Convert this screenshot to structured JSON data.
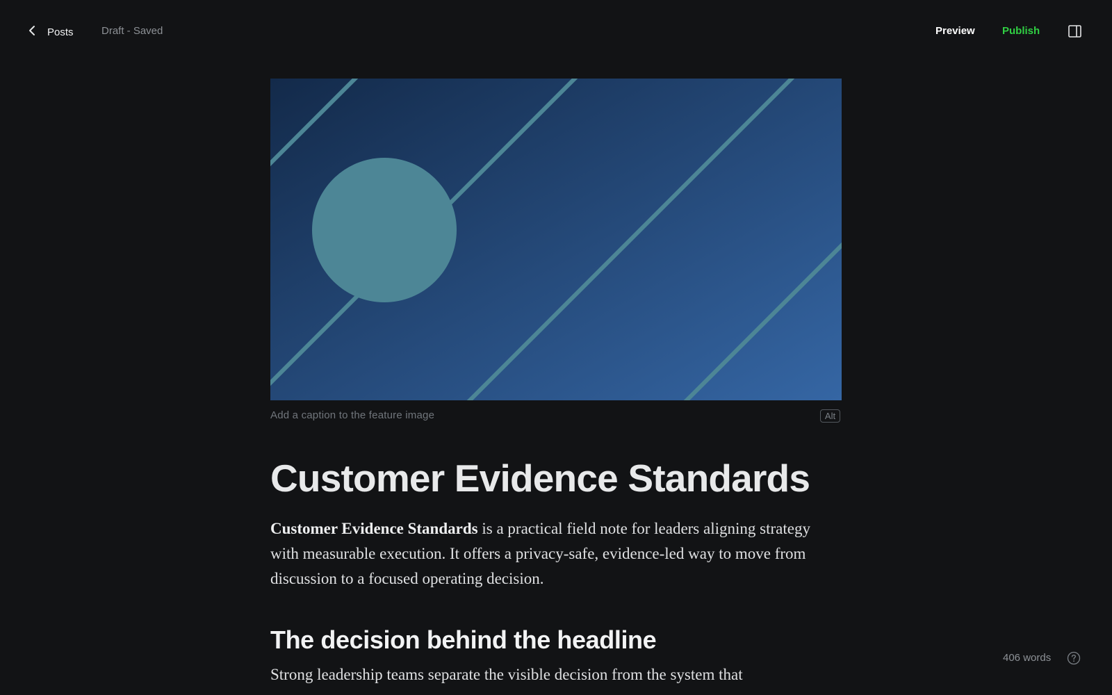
{
  "header": {
    "back_label": "Posts",
    "status": "Draft - Saved",
    "preview_label": "Preview",
    "publish_label": "Publish",
    "publish_color": "#30cf43"
  },
  "icons": {
    "back": "chevron-left-icon",
    "sidebar": "sidebar-toggle-icon",
    "help": "help-circle-icon"
  },
  "feature_image": {
    "caption_placeholder": "Add a caption to the feature image",
    "alt_label": "Alt",
    "colors": {
      "gradient_start": "#132a4a",
      "gradient_end": "#3566a4",
      "accent": "#4d8696"
    }
  },
  "post": {
    "title": "Customer Evidence Standards",
    "lead_bold": "Customer Evidence Standards",
    "lead_text": " is a practical field note for leaders aligning strategy with measurable execution. It offers a privacy-safe, evidence-led way to move from discussion to a focused operating decision.",
    "section_heading": "The decision behind the headline",
    "section_text": "Strong leadership teams separate the visible decision from the system that"
  },
  "footer": {
    "word_count": "406 words"
  }
}
